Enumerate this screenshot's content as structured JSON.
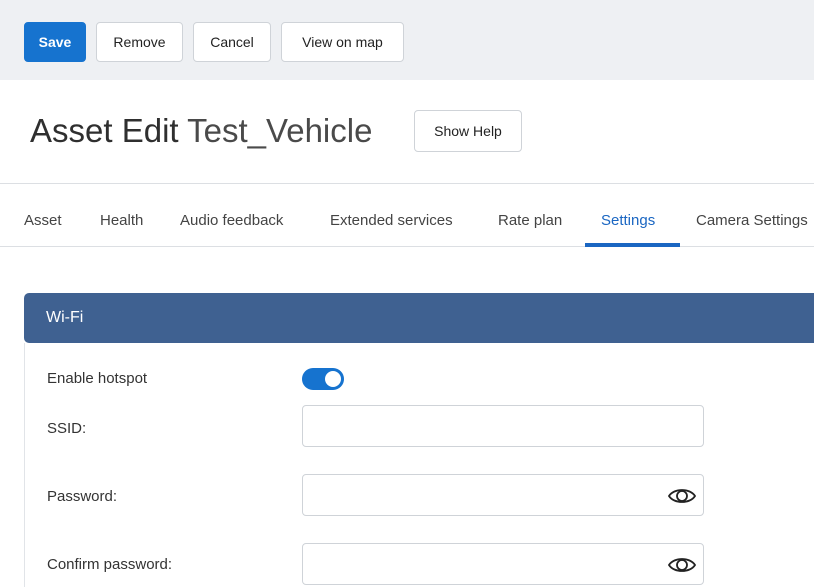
{
  "toolbar": {
    "save_label": "Save",
    "remove_label": "Remove",
    "cancel_label": "Cancel",
    "view_on_map_label": "View on map"
  },
  "header": {
    "title_prefix": "Asset Edit",
    "asset_name": "Test_Vehicle",
    "show_help_label": "Show Help"
  },
  "tabs": [
    {
      "label": "Asset"
    },
    {
      "label": "Health"
    },
    {
      "label": "Audio feedback"
    },
    {
      "label": "Extended services"
    },
    {
      "label": "Rate plan"
    },
    {
      "label": "Settings",
      "active": true
    },
    {
      "label": "Camera Settings"
    }
  ],
  "wifi": {
    "section_title": "Wi-Fi",
    "enable_hotspot_label": "Enable hotspot",
    "enable_hotspot_on": true,
    "ssid_label": "SSID:",
    "ssid_value": "",
    "password_label": "Password:",
    "password_value": "",
    "confirm_password_label": "Confirm password:",
    "confirm_password_value": ""
  },
  "colors": {
    "primary": "#1673cf",
    "section_header": "#3f6191",
    "active_tab": "#1a66c2"
  },
  "icons": {
    "password_reveal": "eye-icon"
  }
}
